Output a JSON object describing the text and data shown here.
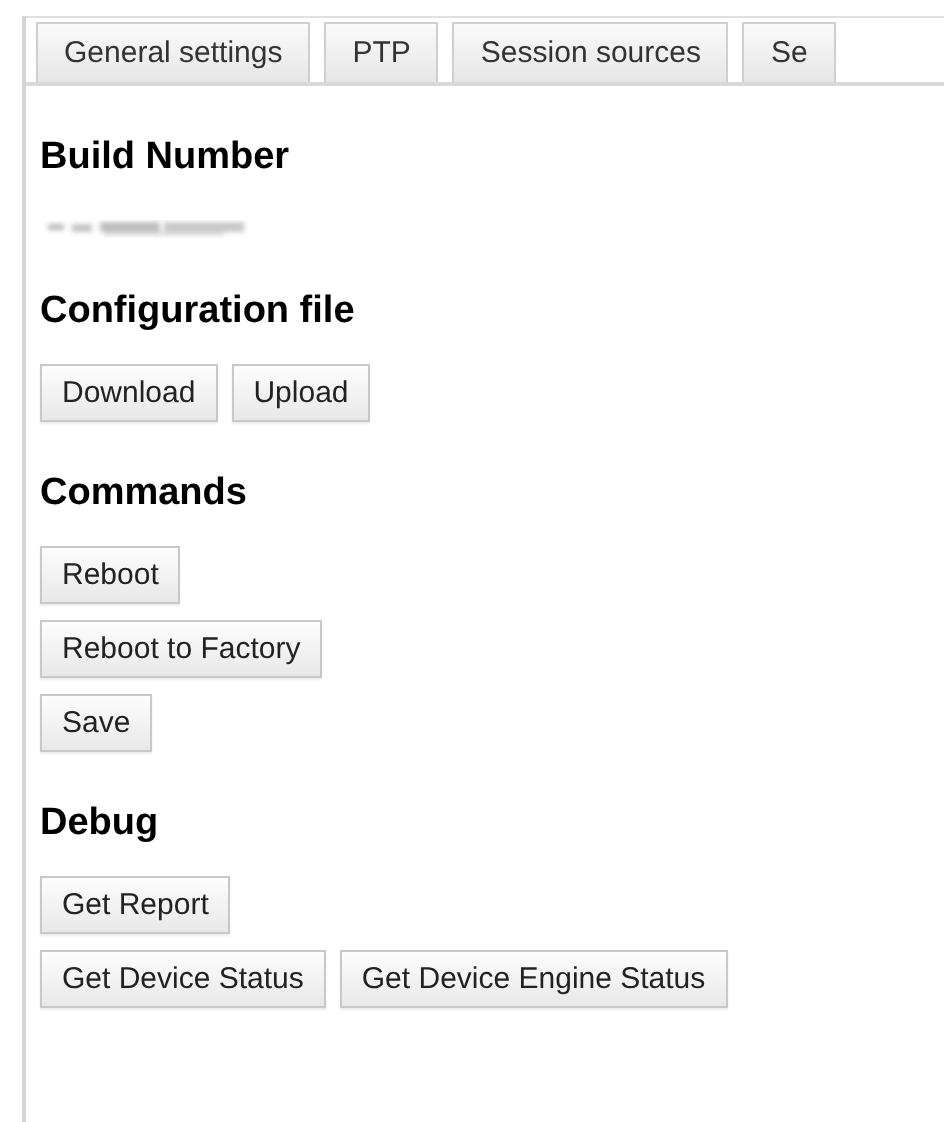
{
  "tabs": [
    {
      "label": "General settings"
    },
    {
      "label": "PTP"
    },
    {
      "label": "Session sources"
    },
    {
      "label": "Se"
    }
  ],
  "sections": [
    {
      "heading": "Build Number",
      "kind": "redacted"
    },
    {
      "heading": "Configuration file",
      "kind": "buttons",
      "rows": [
        [
          "Download",
          "Upload"
        ]
      ]
    },
    {
      "heading": "Commands",
      "kind": "buttons",
      "rows": [
        [
          "Reboot"
        ],
        [
          "Reboot to Factory"
        ],
        [
          "Save"
        ]
      ]
    },
    {
      "heading": "Debug",
      "kind": "buttons",
      "rows": [
        [
          "Get Report"
        ],
        [
          "Get Device Status",
          "Get Device Engine Status"
        ]
      ]
    }
  ]
}
